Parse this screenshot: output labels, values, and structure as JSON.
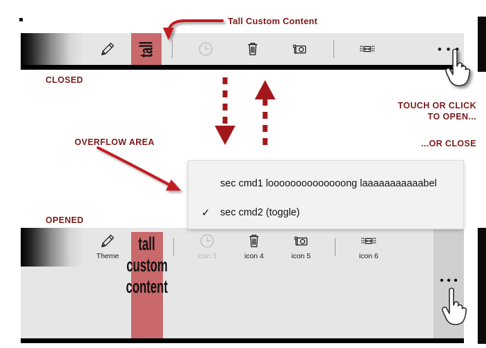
{
  "meta": {
    "accent_red": "#7B1A1A",
    "tall_block_bg": "#c9696b",
    "toolbar_bg": "#e6e6e6",
    "flyout_bg": "#f2f2f2"
  },
  "annotations": {
    "tall_custom_content": "Tall Custom Content",
    "closed": "CLOSED",
    "overflow_area": "OVERFLOW AREA",
    "opened": "OPENED",
    "touch_or_click_line1": "TOUCH OR CLICK",
    "touch_or_click_line2": "TO OPEN...",
    "or_close": "...OR CLOSE"
  },
  "closed_toolbar": {
    "custom_content": "tall",
    "commands": [
      {
        "id": "theme",
        "icon": "pencil-icon",
        "label": "",
        "disabled": false
      },
      {
        "id": "icon3",
        "icon": "clock-icon",
        "label": "",
        "disabled": true
      },
      {
        "id": "icon4",
        "icon": "trash-icon",
        "label": "",
        "disabled": false
      },
      {
        "id": "icon5",
        "icon": "camera-icon",
        "label": "",
        "disabled": false
      },
      {
        "id": "icon6",
        "icon": "fit-width-icon",
        "label": "",
        "disabled": false
      }
    ],
    "overflow_glyph": "• • •"
  },
  "opened_toolbar": {
    "custom_content_lines": [
      "tall",
      "custom",
      "content"
    ],
    "commands": [
      {
        "id": "theme",
        "icon": "pencil-icon",
        "label": "Theme",
        "disabled": false
      },
      {
        "id": "icon3",
        "icon": "clock-icon",
        "label": "icon 3",
        "disabled": true
      },
      {
        "id": "icon4",
        "icon": "trash-icon",
        "label": "icon 4",
        "disabled": false
      },
      {
        "id": "icon5",
        "icon": "camera-icon",
        "label": "icon 5",
        "disabled": false
      },
      {
        "id": "icon6",
        "icon": "fit-width-icon",
        "label": "icon 6",
        "disabled": false
      }
    ],
    "overflow_glyph": "• • •"
  },
  "flyout": {
    "items": [
      {
        "label": "sec cmd1 loooooooooooooong laaaaaaaaaaabel",
        "checked": false,
        "check_glyph": ""
      },
      {
        "label": "sec cmd2 (toggle)",
        "checked": true,
        "check_glyph": "✓"
      }
    ]
  }
}
